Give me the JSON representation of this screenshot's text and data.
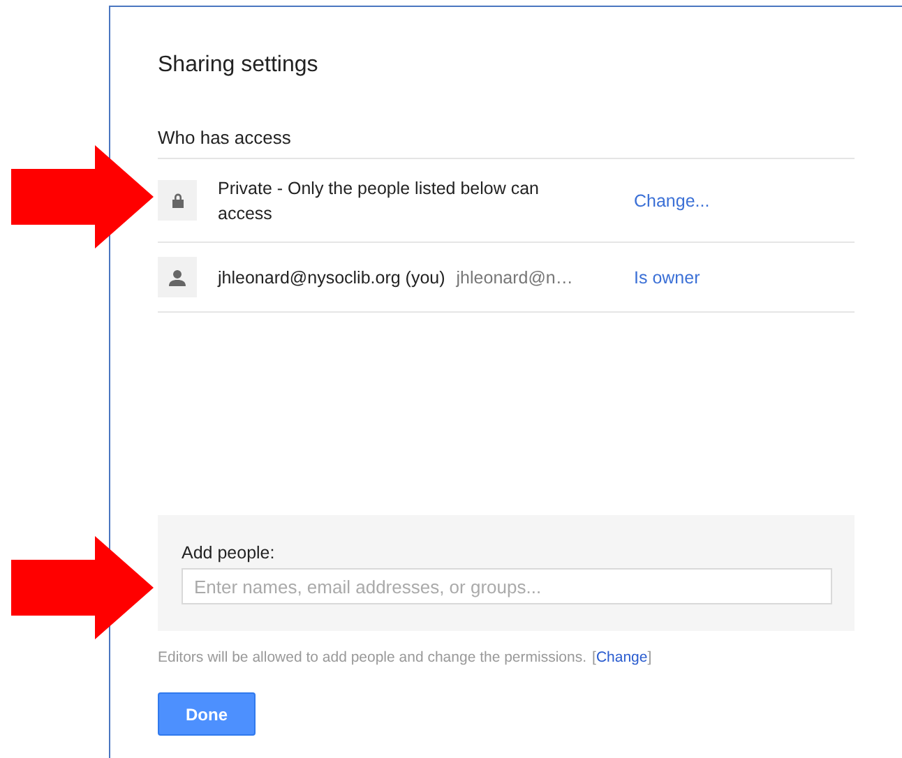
{
  "dialog": {
    "title": "Sharing settings"
  },
  "access": {
    "heading": "Who has access",
    "rows": [
      {
        "kind": "visibility",
        "name": "Private - Only the people listed below can access",
        "action": "Change..."
      },
      {
        "kind": "person",
        "name": "jhleonard@nysoclib.org (you)",
        "secondary": "jhleonard@n…",
        "action": "Is owner"
      }
    ]
  },
  "add_people": {
    "label": "Add people:",
    "placeholder": "Enter names, email addresses, or groups..."
  },
  "footer": {
    "note": "Editors will be allowed to add people and change the permissions.",
    "open_bracket": "[",
    "link": "Change",
    "close_bracket": "]"
  },
  "buttons": [
    {
      "label": "Done"
    }
  ],
  "annotations": [
    {
      "kind": "arrow"
    },
    {
      "kind": "arrow"
    }
  ]
}
